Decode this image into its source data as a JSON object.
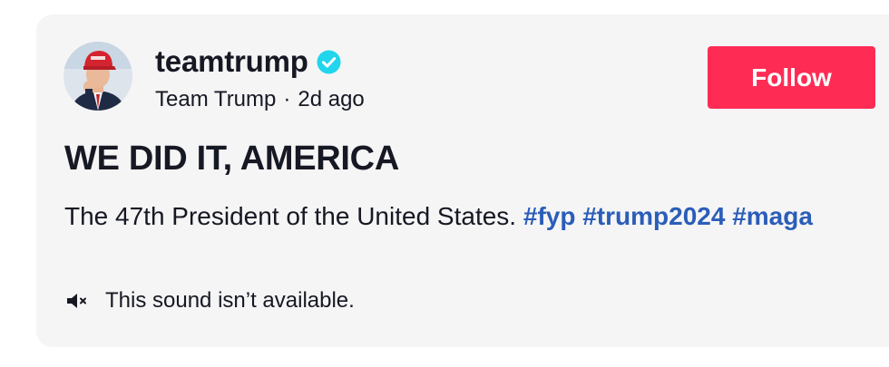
{
  "author": {
    "username": "teamtrump",
    "display_name": "Team Trump",
    "separator": "·",
    "time_ago": "2d ago",
    "verified_icon": "verified-badge-icon",
    "avatar_icon": "profile-photo"
  },
  "follow_button": {
    "label": "Follow"
  },
  "post": {
    "title": "WE DID IT, AMERICA",
    "caption_text": "The 47th President of the United States.",
    "hashtags": [
      "#fyp",
      "#trump2024",
      "#maga"
    ]
  },
  "sound": {
    "icon": "muted-speaker-icon",
    "message": "This sound isn’t available."
  },
  "colors": {
    "card_background": "#f5f5f5",
    "follow_button": "#fe2c55",
    "hashtag": "#2b5db9",
    "verified": "#20d5ec",
    "text": "#161823"
  }
}
